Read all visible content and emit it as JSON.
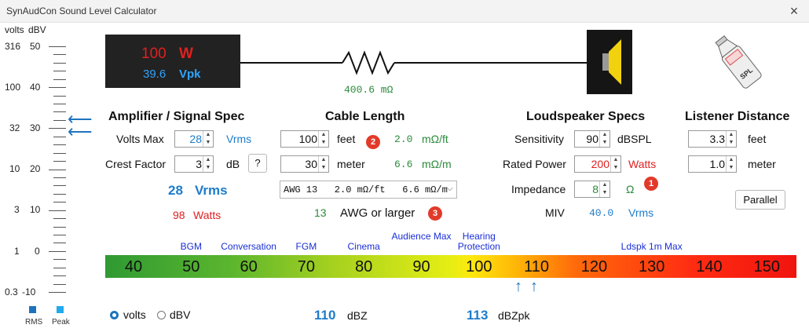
{
  "window": {
    "title": "SynAudCon Sound Level Calculator",
    "close_icon": "close-icon"
  },
  "meter": {
    "volts_header": "volts",
    "dbv_header": "dBV",
    "rows": [
      {
        "volts": "316",
        "dbv": "50"
      },
      {
        "volts": "100",
        "dbv": "40"
      },
      {
        "volts": "32",
        "dbv": "30"
      },
      {
        "volts": "10",
        "dbv": "20"
      },
      {
        "volts": "3",
        "dbv": "10"
      },
      {
        "volts": "1",
        "dbv": "0"
      },
      {
        "volts": "0.3",
        "dbv": "-10"
      }
    ],
    "legend_rms": "RMS",
    "legend_peak": "Peak",
    "rms_color": "#1e73be",
    "peak_color": "#22aaee"
  },
  "amp_display": {
    "watts_value": "100",
    "watts_unit": "W",
    "vpk_value": "39.6",
    "vpk_unit": "Vpk"
  },
  "cable_resistance": "400.6 mΩ",
  "amplifier": {
    "header": "Amplifier / Signal Spec",
    "volts_max_label": "Volts Max",
    "volts_max_value": "28",
    "volts_max_unit": "Vrms",
    "crest_label": "Crest Factor",
    "crest_value": "3",
    "crest_unit": "dB",
    "help_button": "?",
    "vrms_value": "28",
    "vrms_unit": "Vrms",
    "watts_value": "98",
    "watts_unit": "Watts"
  },
  "cable": {
    "header": "Cable Length",
    "feet_value": "100",
    "feet_unit": "feet",
    "feet_res": "2.0",
    "feet_res_unit": "mΩ/ft",
    "meter_value": "30",
    "meter_unit": "meter",
    "meter_res": "6.6",
    "meter_res_unit": "mΩ/m",
    "awg_select": "AWG 13   2.0 mΩ/ft   6.6 mΩ/m",
    "awg_result_value": "13",
    "awg_result_label": "AWG or larger",
    "badge2": "2",
    "badge3": "3"
  },
  "loudspeaker": {
    "header": "Loudspeaker Specs",
    "sensitivity_label": "Sensitivity",
    "sensitivity_value": "90",
    "sensitivity_unit": "dBSPL",
    "power_label": "Rated Power",
    "power_value": "200",
    "power_unit": "Watts",
    "impedance_label": "Impedance",
    "impedance_value": "8",
    "impedance_unit": "Ω",
    "miv_label": "MIV",
    "miv_value": "40.0",
    "miv_unit": "Vrms",
    "badge1": "1"
  },
  "listener": {
    "header": "Listener Distance",
    "feet_value": "3.3",
    "feet_unit": "feet",
    "meter_value": "1.0",
    "meter_unit": "meter",
    "parallel_button": "Parallel"
  },
  "scale": {
    "numbers": [
      "40",
      "50",
      "60",
      "70",
      "80",
      "90",
      "100",
      "110",
      "120",
      "130",
      "140",
      "150"
    ],
    "events": [
      {
        "label": "BGM",
        "level": 50
      },
      {
        "label": "Conversation",
        "level": 60
      },
      {
        "label": "FGM",
        "level": 70
      },
      {
        "label": "Cinema",
        "level": 80
      },
      {
        "label": "Audience Max",
        "level": 90
      },
      {
        "label": "Hearing Protection",
        "level": 100
      },
      {
        "label": "Ldspk 1m Max",
        "level": 130
      }
    ]
  },
  "footer": {
    "volts_radio": "volts",
    "dbv_radio": "dBV",
    "dbz_value": "110",
    "dbz_unit": "dBZ",
    "dbzpk_value": "113",
    "dbzpk_unit": "dBZpk"
  }
}
